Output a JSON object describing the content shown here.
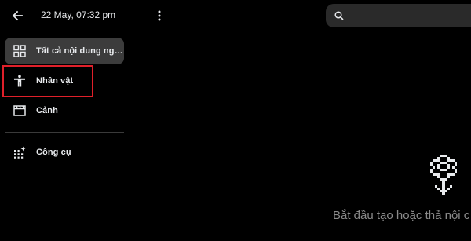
{
  "header": {
    "back_icon": "arrow-back-icon",
    "date": "22 May, 07:32 pm",
    "more_icon": "more-vert-icon"
  },
  "sidebar": {
    "items": [
      {
        "label": "Tất cả nội dung nghe ...",
        "icon": "grid-icon",
        "active": true
      },
      {
        "label": "Nhân vật",
        "icon": "person-icon",
        "active": false,
        "highlighted": true
      },
      {
        "label": "Cảnh",
        "icon": "clapperboard-icon",
        "active": false
      },
      {
        "label": "Công cụ",
        "icon": "sparkle-grid-icon",
        "active": false
      }
    ]
  },
  "search": {
    "icon": "search-icon",
    "placeholder": "",
    "value": ""
  },
  "empty_state": {
    "icon": "flower-icon",
    "text": "Bắt đầu tạo hoặc thả nội c"
  },
  "colors": {
    "background": "#000000",
    "active_item": "#3c3c3c",
    "highlight_border": "#e0202a",
    "muted_text": "#8a8a8a"
  }
}
